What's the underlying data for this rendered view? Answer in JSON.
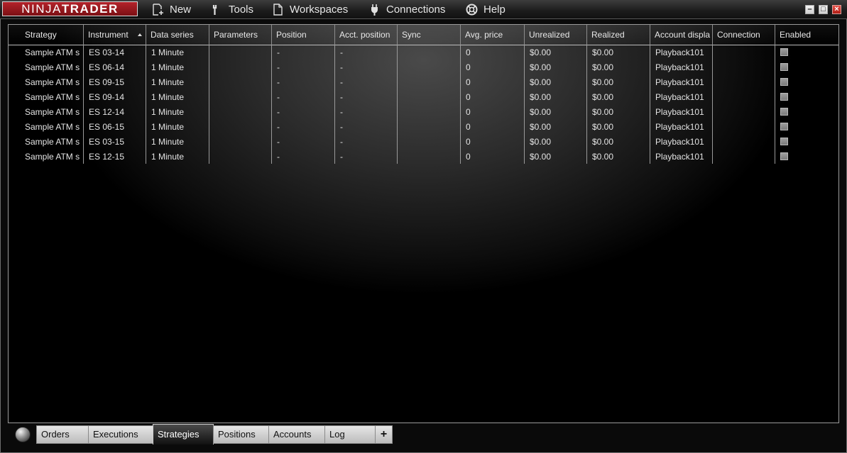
{
  "app": {
    "logo_part1": "NINJA",
    "logo_part2": "TRADER",
    "brand_color": "#9a1a20"
  },
  "menu": [
    {
      "label": "New",
      "icon": "new-document-icon"
    },
    {
      "label": "Tools",
      "icon": "wrench-icon"
    },
    {
      "label": "Workspaces",
      "icon": "document-icon"
    },
    {
      "label": "Connections",
      "icon": "plug-icon"
    },
    {
      "label": "Help",
      "icon": "lifebuoy-icon"
    }
  ],
  "window_controls": {
    "minimize": "–",
    "maximize": "□",
    "close": "×"
  },
  "grid": {
    "columns": [
      "Strategy",
      "Instrument",
      "Data series",
      "Parameters",
      "Position",
      "Acct. position",
      "Sync",
      "Avg. price",
      "Unrealized",
      "Realized",
      "Account displa",
      "Connection",
      "Enabled"
    ],
    "sorted_column": "Instrument",
    "rows": [
      {
        "strategy": "Sample ATM s",
        "instrument": "ES 03-14",
        "data_series": "1 Minute",
        "parameters": "",
        "position": "-",
        "acct_position": "-",
        "sync": "",
        "avg_price": "0",
        "unrealized": "$0.00",
        "realized": "$0.00",
        "account": "Playback101",
        "connection": "",
        "enabled": false
      },
      {
        "strategy": "Sample ATM s",
        "instrument": "ES 06-14",
        "data_series": "1 Minute",
        "parameters": "",
        "position": "-",
        "acct_position": "-",
        "sync": "",
        "avg_price": "0",
        "unrealized": "$0.00",
        "realized": "$0.00",
        "account": "Playback101",
        "connection": "",
        "enabled": false
      },
      {
        "strategy": "Sample ATM s",
        "instrument": "ES 09-15",
        "data_series": "1 Minute",
        "parameters": "",
        "position": "-",
        "acct_position": "-",
        "sync": "",
        "avg_price": "0",
        "unrealized": "$0.00",
        "realized": "$0.00",
        "account": "Playback101",
        "connection": "",
        "enabled": false
      },
      {
        "strategy": "Sample ATM s",
        "instrument": "ES 09-14",
        "data_series": "1 Minute",
        "parameters": "",
        "position": "-",
        "acct_position": "-",
        "sync": "",
        "avg_price": "0",
        "unrealized": "$0.00",
        "realized": "$0.00",
        "account": "Playback101",
        "connection": "",
        "enabled": false
      },
      {
        "strategy": "Sample ATM s",
        "instrument": "ES 12-14",
        "data_series": "1 Minute",
        "parameters": "",
        "position": "-",
        "acct_position": "-",
        "sync": "",
        "avg_price": "0",
        "unrealized": "$0.00",
        "realized": "$0.00",
        "account": "Playback101",
        "connection": "",
        "enabled": false
      },
      {
        "strategy": "Sample ATM s",
        "instrument": "ES 06-15",
        "data_series": "1 Minute",
        "parameters": "",
        "position": "-",
        "acct_position": "-",
        "sync": "",
        "avg_price": "0",
        "unrealized": "$0.00",
        "realized": "$0.00",
        "account": "Playback101",
        "connection": "",
        "enabled": false
      },
      {
        "strategy": "Sample ATM s",
        "instrument": "ES 03-15",
        "data_series": "1 Minute",
        "parameters": "",
        "position": "-",
        "acct_position": "-",
        "sync": "",
        "avg_price": "0",
        "unrealized": "$0.00",
        "realized": "$0.00",
        "account": "Playback101",
        "connection": "",
        "enabled": false
      },
      {
        "strategy": "Sample ATM s",
        "instrument": "ES 12-15",
        "data_series": "1 Minute",
        "parameters": "",
        "position": "-",
        "acct_position": "-",
        "sync": "",
        "avg_price": "0",
        "unrealized": "$0.00",
        "realized": "$0.00",
        "account": "Playback101",
        "connection": "",
        "enabled": false
      }
    ]
  },
  "tabs": {
    "items": [
      "Orders",
      "Executions",
      "Strategies",
      "Positions",
      "Accounts",
      "Log"
    ],
    "active": "Strategies",
    "add_label": "+"
  }
}
